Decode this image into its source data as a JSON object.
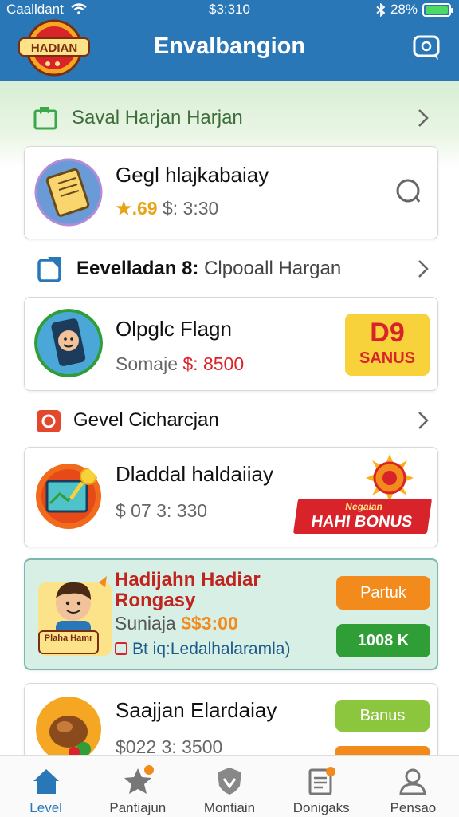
{
  "status": {
    "carrier": "Caalldant",
    "time": "$3:310",
    "battery": "28%"
  },
  "header": {
    "logo_text": "HADIAN",
    "title": "Envalbangion"
  },
  "colors": {
    "header": "#2a77b8",
    "green": "#2f9e36",
    "orange": "#f28a1c",
    "red": "#d9232a",
    "yellow": "#f7d23a"
  },
  "sections": [
    {
      "label": "Saval Harjan Harjan",
      "icon": "section-green-icon"
    },
    {
      "label_bold": "Eevelladan 8:",
      "label": " Clpooall Hargan",
      "icon": "section-blue-icon"
    },
    {
      "label": "Gevel Cicharcjan",
      "icon": "section-red-icon"
    }
  ],
  "cards": [
    {
      "title": "Gegl hlajkabaiay",
      "rating": "★.69",
      "price": "$: 3:30",
      "icon": "tablet-icon",
      "action_icon": "radio-circle-icon"
    },
    {
      "title": "Olpglc Flagn",
      "sub_label": "Somaje",
      "price": "$: 8500",
      "icon": "phone-icon",
      "badge_num": "D9",
      "badge_text": "SANUS"
    },
    {
      "title": "Dladdal haldaiiay",
      "price": "$ 07  3: 330",
      "icon": "map-icon",
      "badge_top": "Negaian",
      "badge_text": "HAHI BONUS"
    },
    {
      "title_line1": "Hadijahn Hadiar",
      "title_line2": "Rongasy",
      "sub_label": "Suniaja",
      "price": "$$3:00",
      "note": "Bt iq:Ledalhalaramla)",
      "icon": "boy-icon",
      "avatar_label": "Plaha Hamr",
      "btn_orange": "Partuk",
      "btn_green": "1008 K"
    },
    {
      "title": "Saajjan Elardaiay",
      "price": "$022  3: 3500",
      "icon": "food-icon",
      "btn_green": "Banus"
    }
  ],
  "nav": [
    {
      "label": "Level",
      "icon": "home-icon",
      "active": true
    },
    {
      "label": "Pantiajun",
      "icon": "star-icon"
    },
    {
      "label": "Montiain",
      "icon": "shield-icon"
    },
    {
      "label": "Donigaks",
      "icon": "document-icon"
    },
    {
      "label": "Pensao",
      "icon": "user-icon"
    }
  ]
}
